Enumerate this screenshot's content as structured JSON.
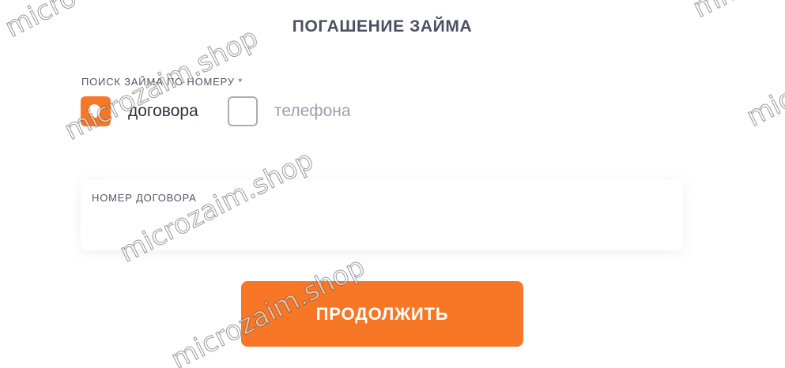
{
  "page": {
    "title": "ПОГАШЕНИЕ ЗАЙМА"
  },
  "search": {
    "label": "ПОИСК ЗАЙМА ПО НОМЕРУ *",
    "options": [
      {
        "label": "договора",
        "checked": true
      },
      {
        "label": "телефона",
        "checked": false
      }
    ]
  },
  "contract_field": {
    "label": "НОМЕР ДОГОВОРА",
    "value": "",
    "placeholder": ""
  },
  "submit": {
    "label": "ПРОДОЛЖИТЬ"
  },
  "watermarks": {
    "text_1": "microzaim.shop",
    "text_2": "microzaim.shop",
    "text_3": "microzaim.shop",
    "text_4": "micro",
    "text_5": "micr",
    "text_6": "micr"
  },
  "colors": {
    "accent": "#f77726",
    "title_text": "#4a5062",
    "label_text": "#4f5566",
    "muted_text": "#9aa1b1",
    "checkbox_border": "#a7adba"
  }
}
